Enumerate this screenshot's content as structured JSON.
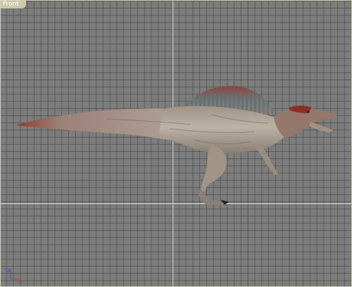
{
  "viewport": {
    "label": "Front",
    "label_color": "#ffffff",
    "tab_color": "#c9c9a7",
    "background_color": "#7d7d7d",
    "model": "spinosaurus"
  },
  "gizmo": {
    "axis_z": "z",
    "axis_x": "x",
    "z_color": "#3a48d8",
    "x_color": "#d83a3a"
  }
}
